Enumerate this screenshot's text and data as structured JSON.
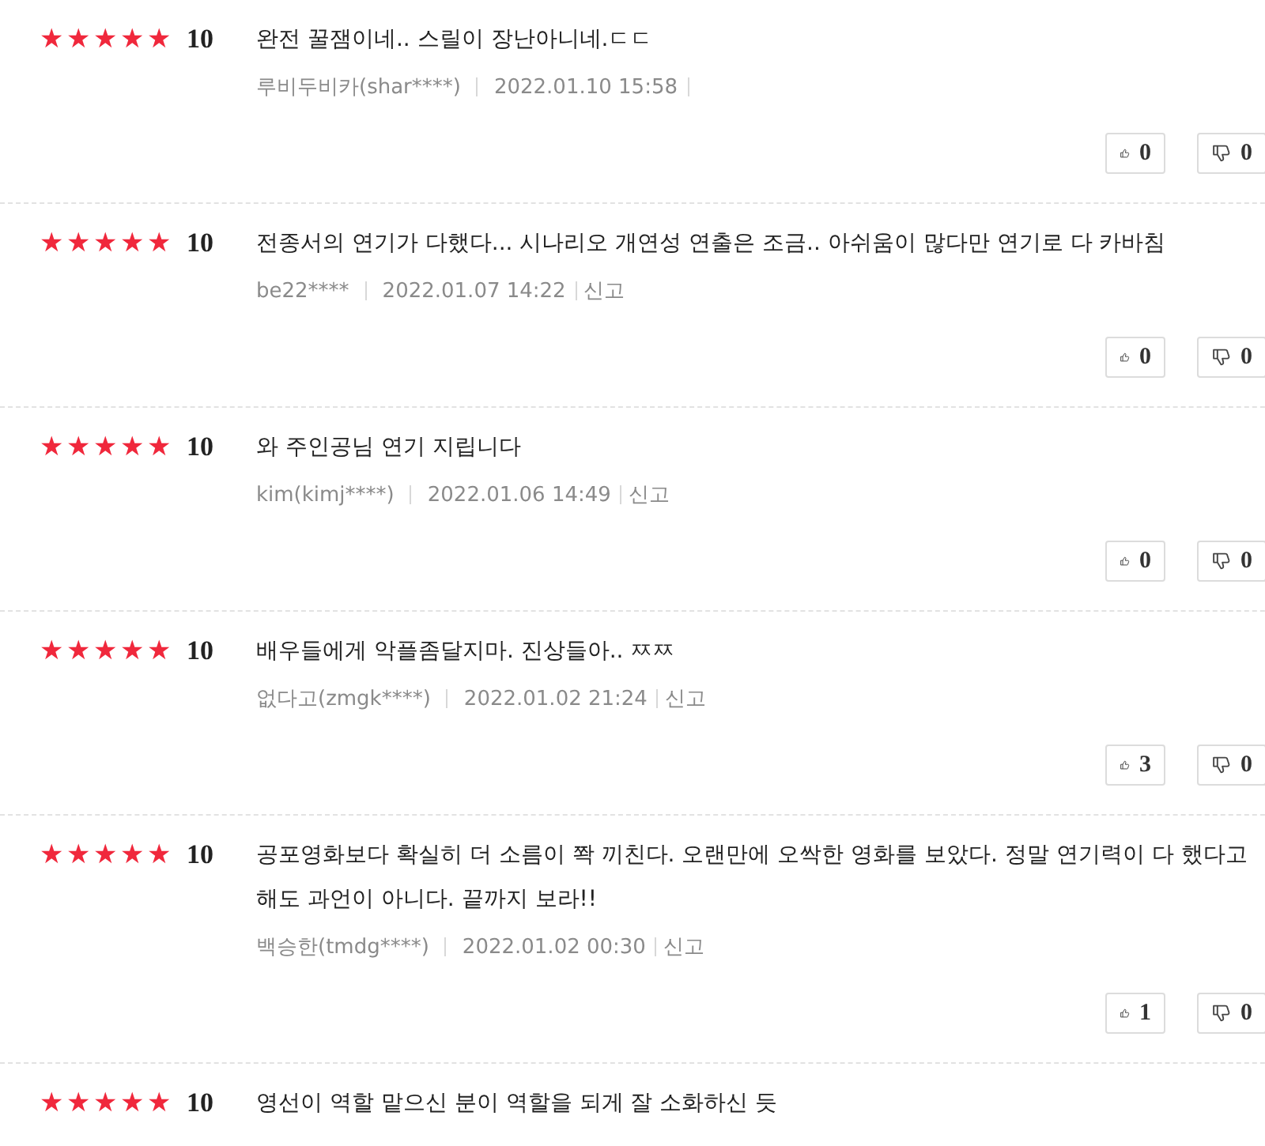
{
  "reviews": [
    {
      "stars": 5,
      "score": "10",
      "text": "완전 꿀잼이네.. 스릴이 장난아니네.ㄷㄷ",
      "author": "루비두비카(shar****)",
      "date": "2022.01.10 15:58",
      "likes": "0",
      "dislikes": "0"
    },
    {
      "stars": 5,
      "score": "10",
      "text": "전종서의 연기가 다했다... 시나리오 개연성 연출은 조금.. 아쉬움이 많다만 연기로 다 카바침",
      "author": "be22****",
      "date": "2022.01.07 14:22",
      "report": "신고",
      "likes": "0",
      "dislikes": "0"
    },
    {
      "stars": 5,
      "score": "10",
      "text": "와 주인공님 연기 지립니다",
      "author": "kim(kimj****)",
      "date": "2022.01.06 14:49",
      "report": "신고",
      "likes": "0",
      "dislikes": "0"
    },
    {
      "stars": 5,
      "score": "10",
      "text": "배우들에게 악플좀달지마. 진상들아.. ㅉㅉ",
      "author": "없다고(zmgk****)",
      "date": "2022.01.02 21:24",
      "report": "신고",
      "likes": "3",
      "dislikes": "0"
    },
    {
      "stars": 5,
      "score": "10",
      "text": "공포영화보다 확실히 더 소름이 쫙 끼친다. 오랜만에 오싹한 영화를 보았다. 정말 연기력이 다 했다고 해도 과언이 아니다. 끝까지 보라!!",
      "author": "백승한(tmdg****)",
      "date": "2022.01.02 00:30",
      "report": "신고",
      "likes": "1",
      "dislikes": "0"
    },
    {
      "stars": 5,
      "score": "10",
      "text": "영선이 역할 맡으신 분이 역할을 되게 잘 소화하신 듯"
    }
  ]
}
